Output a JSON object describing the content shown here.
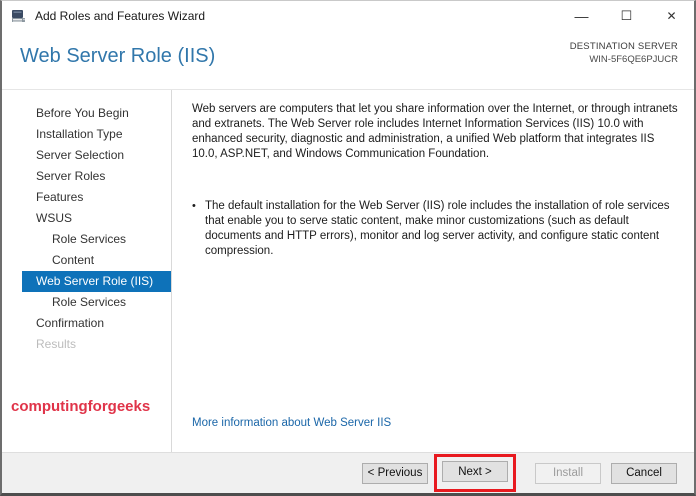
{
  "window": {
    "title": "Add Roles and Features Wizard",
    "controls": {
      "minimize": "—",
      "maximize": "☐",
      "close": "✕"
    }
  },
  "header": {
    "title": "Web Server Role (IIS)",
    "destination_label": "DESTINATION SERVER",
    "destination_server": "WIN-5F6QE6PJUCR"
  },
  "sidebar": {
    "items": [
      {
        "label": "Before You Begin",
        "indent": 0,
        "state": "normal"
      },
      {
        "label": "Installation Type",
        "indent": 0,
        "state": "normal"
      },
      {
        "label": "Server Selection",
        "indent": 0,
        "state": "normal"
      },
      {
        "label": "Server Roles",
        "indent": 0,
        "state": "normal"
      },
      {
        "label": "Features",
        "indent": 0,
        "state": "normal"
      },
      {
        "label": "WSUS",
        "indent": 0,
        "state": "normal"
      },
      {
        "label": "Role Services",
        "indent": 1,
        "state": "normal"
      },
      {
        "label": "Content",
        "indent": 1,
        "state": "normal"
      },
      {
        "label": "Web Server Role (IIS)",
        "indent": 0,
        "state": "selected"
      },
      {
        "label": "Role Services",
        "indent": 1,
        "state": "normal"
      },
      {
        "label": "Confirmation",
        "indent": 0,
        "state": "normal"
      },
      {
        "label": "Results",
        "indent": 0,
        "state": "disabled"
      }
    ],
    "watermark": "computingforgeeks"
  },
  "content": {
    "intro_paragraph": "Web servers are computers that let you share information over the Internet, or through intranets and extranets. The Web Server role includes Internet Information Services (IIS) 10.0 with enhanced security, diagnostic and administration, a unified Web platform that integrates IIS 10.0, ASP.NET, and Windows Communication Foundation.",
    "bullet_glyph": "•",
    "bullet_paragraph": "The default installation for the Web Server (IIS) role includes the installation of role services that enable you to serve static content, make minor customizations (such as default documents and HTTP errors), monitor and log server activity, and configure static content compression.",
    "more_info_link": "More information about Web Server IIS"
  },
  "footer": {
    "previous_label": "< Previous",
    "next_label": "Next >",
    "install_label": "Install",
    "cancel_label": "Cancel"
  },
  "colors": {
    "nav_selected_bg": "#0e72b9",
    "heading_blue": "#3177ab",
    "link_blue": "#1a66a8",
    "watermark_red": "#e03449",
    "annotation_red": "#e8191f",
    "footer_bg": "#f0f0f0"
  }
}
